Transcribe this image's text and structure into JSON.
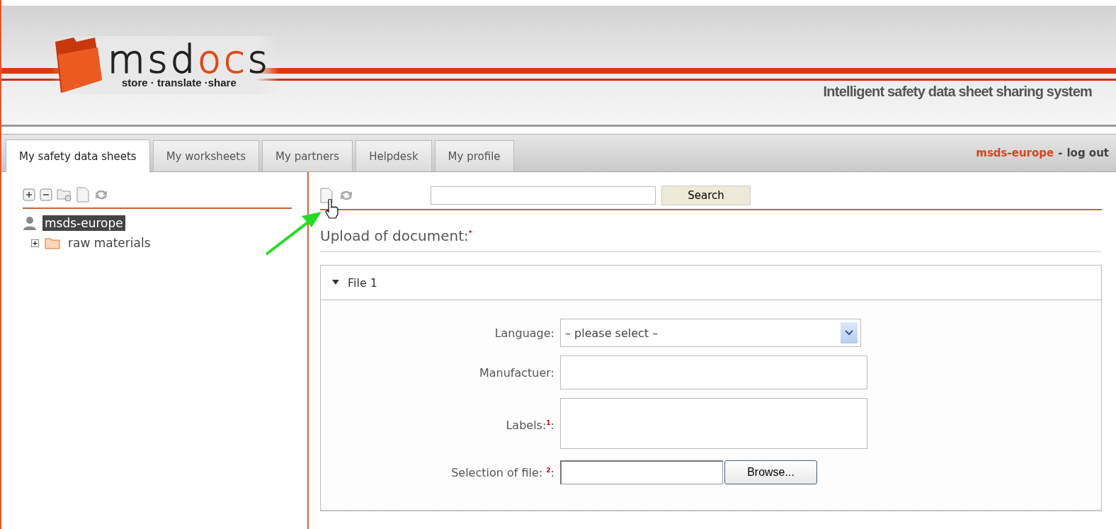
{
  "header": {
    "logo": {
      "parts": [
        {
          "text": "msd",
          "accent": false
        },
        {
          "text": "oc",
          "accent": true
        },
        {
          "text": "s",
          "accent": false
        }
      ],
      "tagline": "store · translate ·share"
    },
    "slogan": "Intelligent safety data sheet sharing system"
  },
  "tabs": [
    {
      "label": "My safety data sheets",
      "selected": true
    },
    {
      "label": "My worksheets",
      "selected": false
    },
    {
      "label": "My partners",
      "selected": false
    },
    {
      "label": "Helpdesk",
      "selected": false
    },
    {
      "label": "My profile",
      "selected": false
    }
  ],
  "user": {
    "name": "msds-europe",
    "separator": "-",
    "logout": "log out"
  },
  "tree": {
    "items": [
      {
        "label": "msds-europe",
        "kind": "user",
        "selected": true,
        "children": [
          {
            "label": "raw materials",
            "kind": "folder",
            "selected": false,
            "expanded": false
          }
        ]
      }
    ]
  },
  "search": {
    "button": "Search"
  },
  "upload": {
    "title": "Upload of document:$^{*}$",
    "section": {
      "title": "File 1",
      "expanded": true,
      "fields": [
        {
          "kind": "select",
          "label": "Language:",
          "value": "– please select –"
        },
        {
          "kind": "text",
          "label": "Manufactuer:"
        },
        {
          "kind": "textarea",
          "label": "Labels:$^{1}$:"
        },
        {
          "kind": "file",
          "label": "Selection of file: $^{2}$:",
          "button": "Browse..."
        }
      ]
    }
  }
}
